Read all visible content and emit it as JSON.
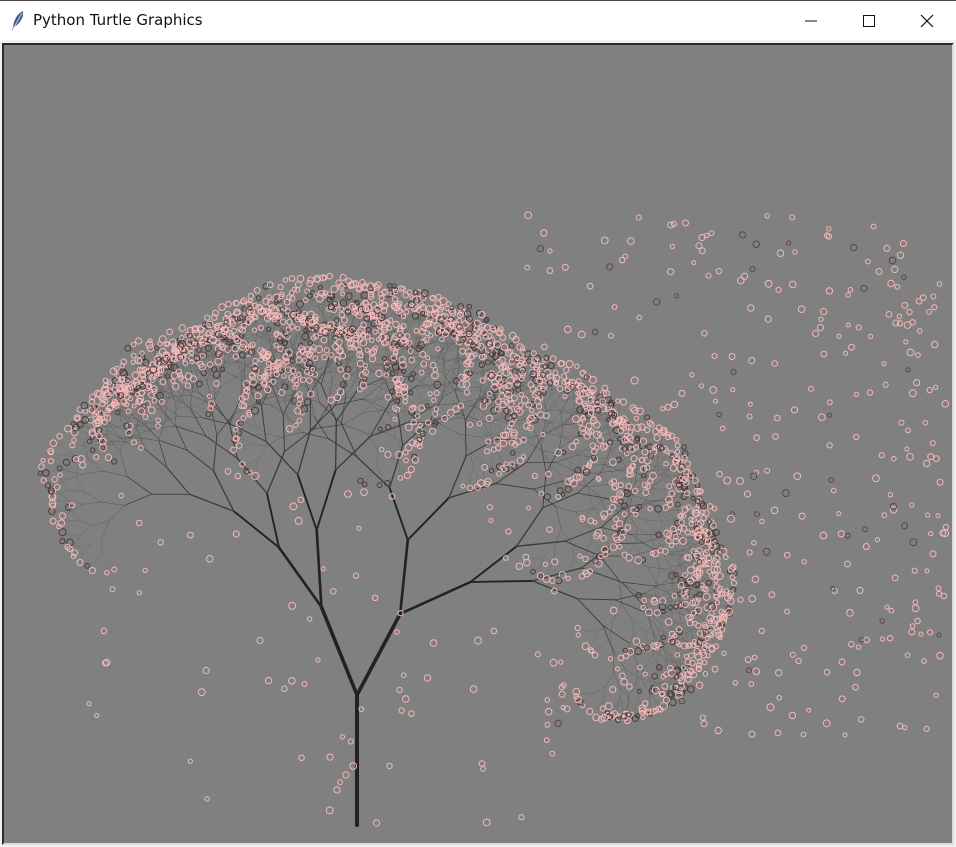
{
  "window": {
    "title": "Python Turtle Graphics",
    "icon": "feather-icon",
    "controls": [
      "minimize-icon",
      "maximize-icon",
      "close-icon"
    ]
  },
  "canvas": {
    "background_color": "#808080",
    "content": "fractal tree with pink blossoms",
    "branch_colors": [
      "#222222",
      "#3c3c3c",
      "#505050"
    ],
    "blossom_color": "#f4b8b8"
  }
}
